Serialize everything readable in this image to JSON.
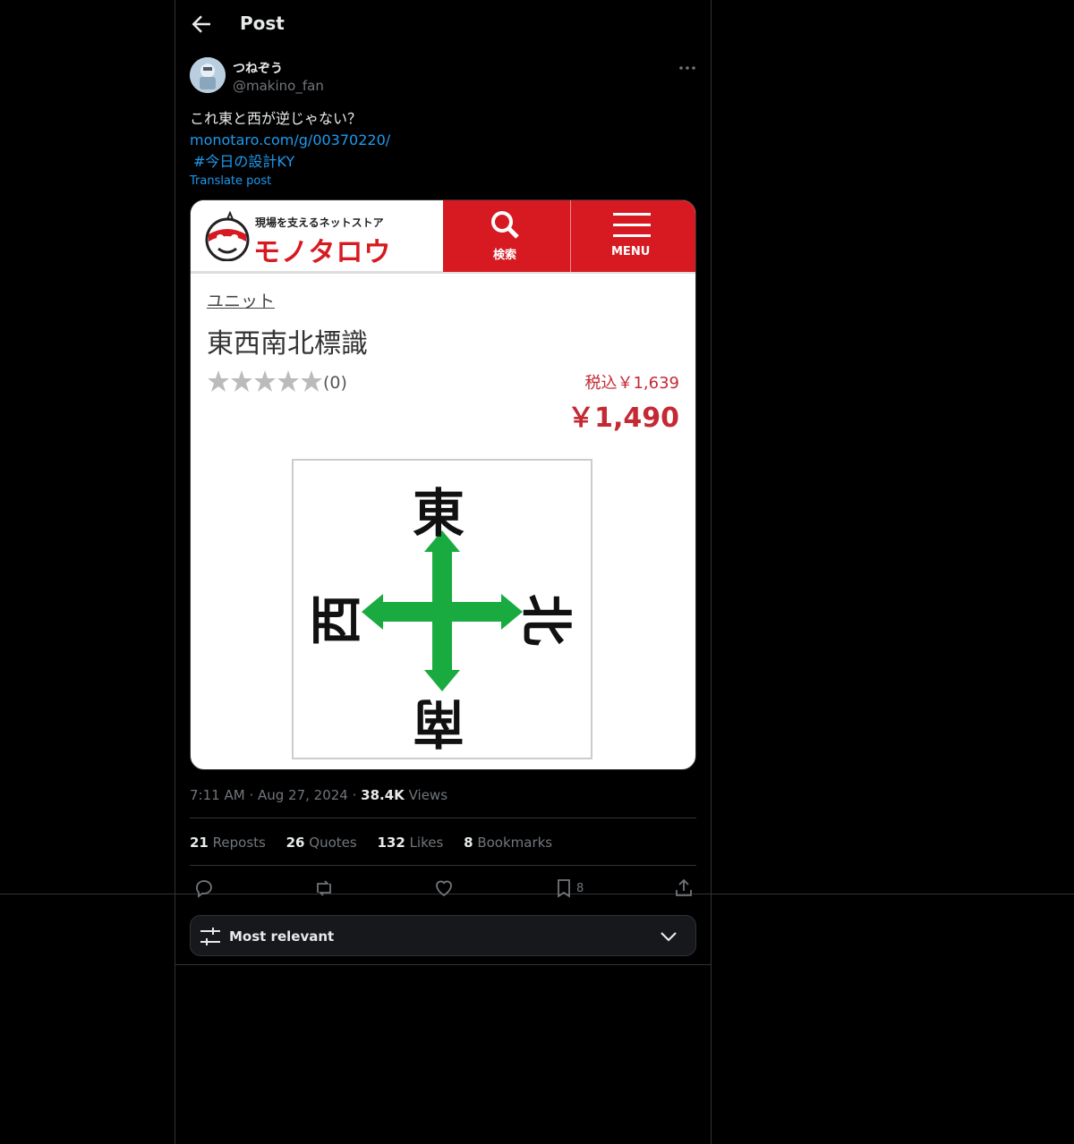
{
  "header": {
    "title": "Post"
  },
  "author": {
    "name": "つねぞう",
    "handle": "@makino_fan"
  },
  "post": {
    "text": "これ東と西が逆じゃない？",
    "link": "monotaro.com/g/00370220/",
    "hashtag": "#今日の設計KY",
    "translate_label": "Translate post"
  },
  "media": {
    "site_tagline": "現場を支えるネットストア",
    "site_logo": "モノタロウ",
    "search_label": "検索",
    "menu_label": "MENU",
    "breadcrumb": "ユニット",
    "product_title": "東西南北標識",
    "rating_count": "(0)",
    "price_tax": "税込￥1,639",
    "price": "￥1,490",
    "sign": {
      "top": "東",
      "left": "西",
      "right": "北",
      "bottom": "南",
      "arrow_color": "#1aab40"
    }
  },
  "meta": {
    "time": "7:11 AM",
    "date": "Aug 27, 2024",
    "views_count": "38.4K",
    "views_label": "Views"
  },
  "stats": [
    {
      "count": "21",
      "label": "Reposts"
    },
    {
      "count": "26",
      "label": "Quotes"
    },
    {
      "count": "132",
      "label": "Likes"
    },
    {
      "count": "8",
      "label": "Bookmarks"
    }
  ],
  "actions": {
    "reply_icon": "reply-icon",
    "repost_icon": "repost-icon",
    "like_icon": "heart-icon",
    "bookmark_icon": "bookmark-icon",
    "bookmark_count": "8",
    "share_icon": "share-icon"
  },
  "sort": {
    "label": "Most relevant"
  },
  "colors": {
    "link": "#1d9bf0",
    "brand_red": "#d71a21"
  }
}
